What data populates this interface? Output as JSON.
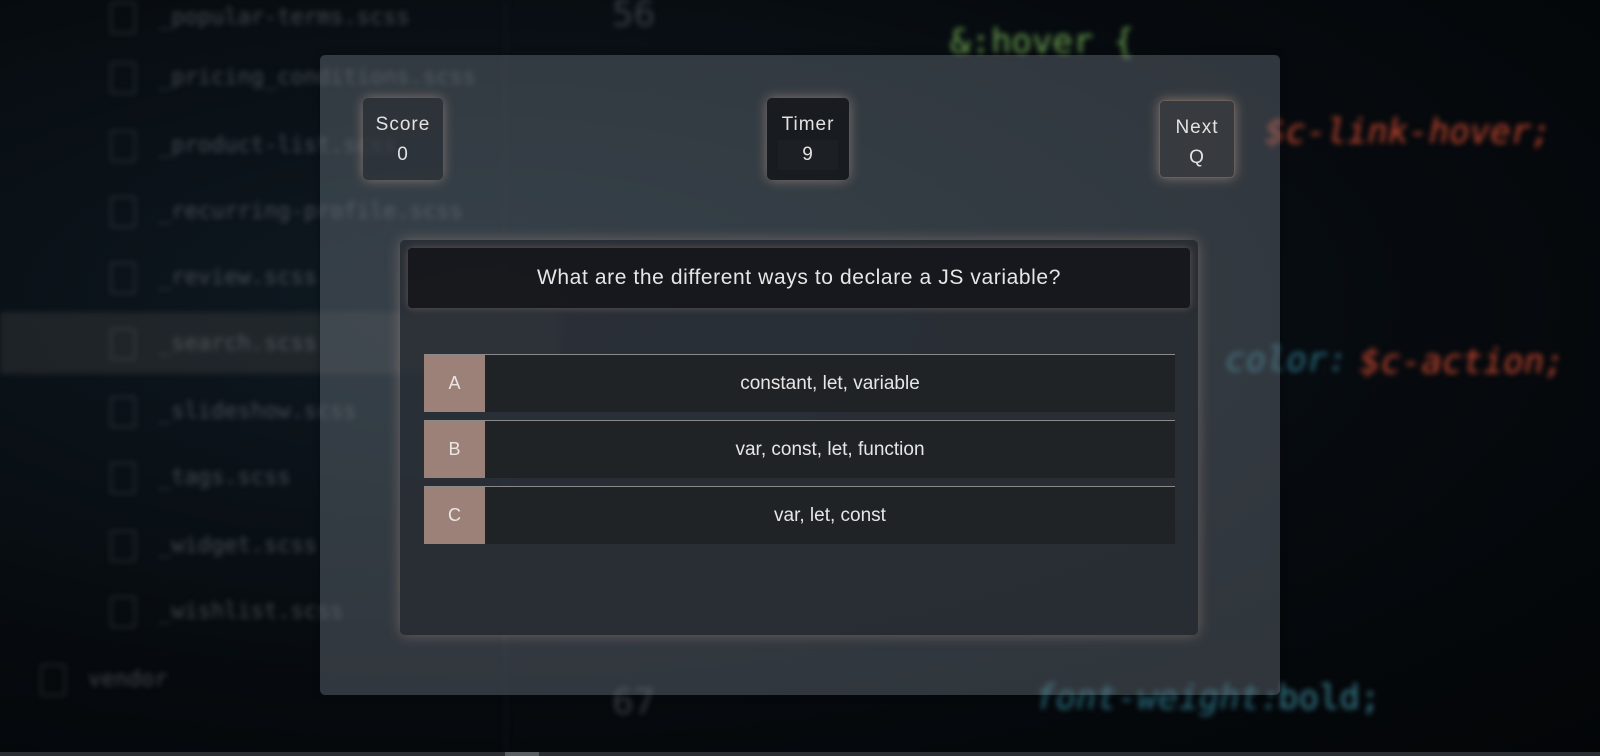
{
  "stats": {
    "score_label": "Score",
    "score_value": "0",
    "timer_label": "Timer",
    "timer_value": "9",
    "next_label": "Next",
    "next_sub": "Q"
  },
  "question": {
    "text": "What are the different ways to declare a JS variable?"
  },
  "answers": [
    {
      "letter": "A",
      "text": "constant, let, variable"
    },
    {
      "letter": "B",
      "text": "var, const, let, function"
    },
    {
      "letter": "C",
      "text": "var, let, const"
    }
  ],
  "background": {
    "files": [
      "_popular-terms.scss",
      "_pricing_conditions.scss",
      "_product-list.scss",
      "_recurring-profile.scss",
      "_review.scss",
      "_search.scss",
      "_slideshow.scss",
      "_tags.scss",
      "_widget.scss",
      "_wishlist.scss",
      "vendor"
    ],
    "line_numbers": [
      "56",
      "67"
    ],
    "code": {
      "hover": "&:hover {",
      "hover_color": "$c-link-hover;",
      "bg_color": "color:",
      "action": "$c-action;",
      "font_weight": "font-weight:",
      "bold": "bold;"
    }
  },
  "colors": {
    "letter_bg": "#9c8179",
    "answer_bg": "#202326",
    "panel_bg": "#6e7680"
  }
}
